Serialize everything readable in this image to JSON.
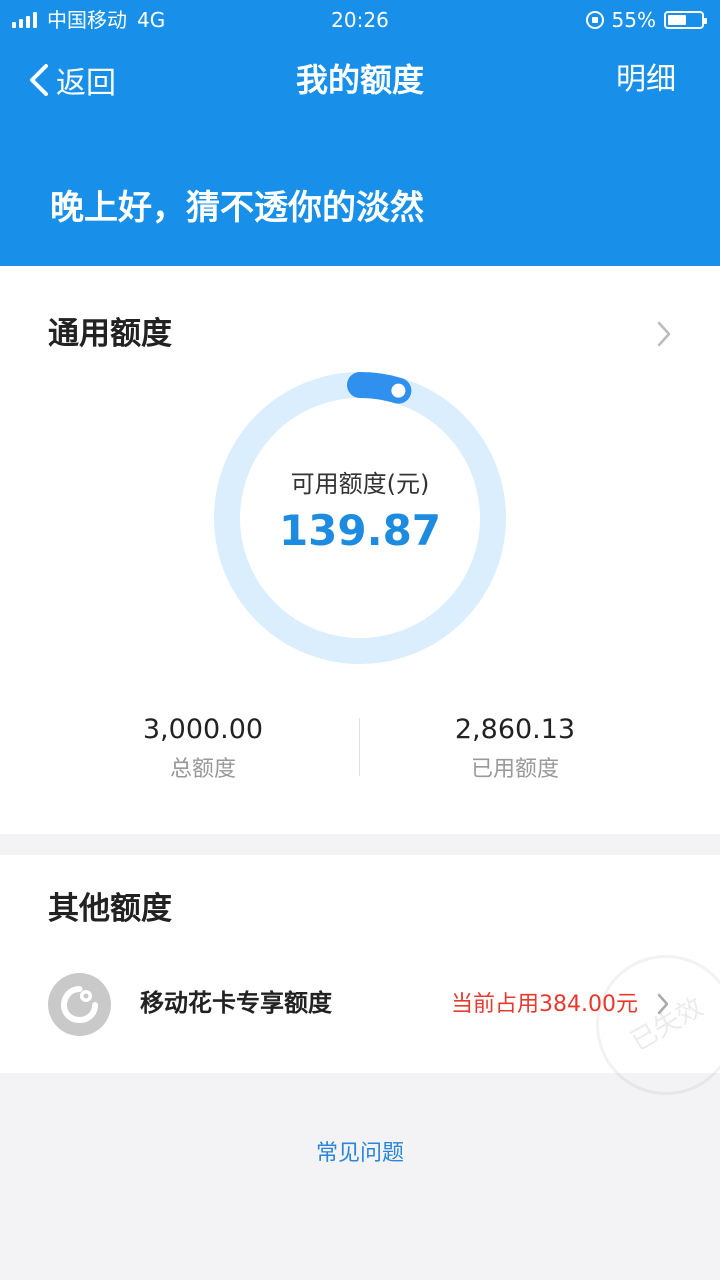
{
  "status_bar": {
    "carrier": "中国移动",
    "network": "4G",
    "time": "20:26",
    "battery_percent": "55%",
    "battery_level": 0.55
  },
  "nav": {
    "back_label": "返回",
    "title": "我的额度",
    "detail_label": "明细"
  },
  "greeting": "晚上好，猜不透你的淡然",
  "general_quota": {
    "title": "通用额度",
    "available_label": "可用额度(元)",
    "available_value": "139.87",
    "available_fraction": 0.0466,
    "total_value": "3,000.00",
    "total_label": "总额度",
    "used_value": "2,860.13",
    "used_label": "已用额度"
  },
  "other_quota": {
    "title": "其他额度",
    "items": [
      {
        "label": "移动花卡专享额度",
        "status": "当前占用384.00元",
        "stamp_text": "已失效"
      }
    ]
  },
  "faq_label": "常见问题",
  "colors": {
    "primary_blue": "#1890ea",
    "accent_blue": "#1d8be0",
    "ring_track": "#dbeefd",
    "alert_red": "#e8392f",
    "page_bg": "#f3f3f5"
  },
  "icons": [
    "signal-icon",
    "lock-rotation-icon",
    "battery-icon",
    "back-chevron-icon",
    "chevron-right-icon",
    "huaka-logo-icon"
  ]
}
